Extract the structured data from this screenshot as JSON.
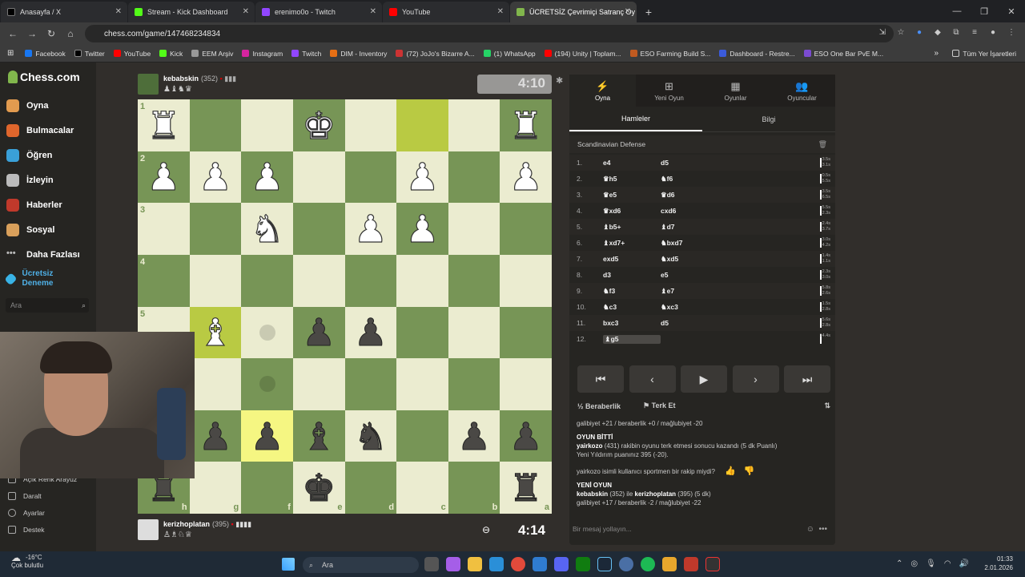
{
  "browser": {
    "tabs": [
      {
        "title": "Anasayfa / X",
        "color": "#000000"
      },
      {
        "title": "Stream - Kick Dashboard",
        "color": "#53fc18"
      },
      {
        "title": "erenimo0o - Twitch",
        "color": "#9146ff"
      },
      {
        "title": "YouTube",
        "color": "#ff0000"
      },
      {
        "title": "ÜCRETSİZ Çevrimiçi Satranç Oy",
        "color": "#81b64c"
      }
    ],
    "url": "chess.com/game/147468234834",
    "bookmarks": [
      "Facebook",
      "Twitter",
      "YouTube",
      "Kick",
      "EEM Arşiv",
      "Instagram",
      "Twitch",
      "DIM - Inventory",
      "(72) JoJo's Bizarre A...",
      "(1) WhatsApp",
      "(194) Unity | Toplam...",
      "ESO Farming Build S...",
      "Dashboard - Restre...",
      "ESO One Bar PvE M..."
    ],
    "bookmarks_all": "Tüm Yer İşaretleri"
  },
  "sidebar": {
    "logo": "Chess.com",
    "items": [
      "Oyna",
      "Bulmacalar",
      "Öğren",
      "İzleyin",
      "Haberler",
      "Sosyal",
      "Daha Fazlası",
      "Ücretsiz Deneme"
    ],
    "search_placeholder": "Ara",
    "bottom": [
      "Açık Renk Arayüz",
      "Daralt",
      "Ayarlar",
      "Destek"
    ]
  },
  "game": {
    "top_player": {
      "name": "kebabskin",
      "rating": "(352)",
      "clock": "4:10"
    },
    "bottom_player": {
      "name": "kerizhoplatan",
      "rating": "(395)",
      "clock": "4:14"
    },
    "ranks": [
      "1",
      "2",
      "3",
      "4",
      "5",
      "6",
      "7",
      "8"
    ],
    "files": [
      "h",
      "g",
      "f",
      "e",
      "d",
      "c",
      "b",
      "a"
    ],
    "board": [
      [
        "wR",
        "",
        "",
        "wK",
        "",
        "",
        "",
        "wR"
      ],
      [
        "wP",
        "wP",
        "wP",
        "",
        "",
        "wP",
        "",
        "wP"
      ],
      [
        "",
        "",
        "wN",
        "",
        "wP",
        "wP",
        "",
        ""
      ],
      [
        "",
        "",
        "",
        "",
        "",
        "",
        "",
        ""
      ],
      [
        "",
        "wB",
        "",
        "bP",
        "bP",
        "",
        "",
        ""
      ],
      [
        "",
        "",
        "",
        "",
        "",
        "",
        "",
        ""
      ],
      [
        "",
        "bP",
        "bP",
        "bB",
        "bN",
        "",
        "bP",
        "bP"
      ],
      [
        "bR",
        "",
        "",
        "bK",
        "",
        "",
        "",
        "bR"
      ]
    ]
  },
  "panel": {
    "tabs": [
      "Oyna",
      "Yeni Oyun",
      "Oyunlar",
      "Oyuncular"
    ],
    "subtabs": [
      "Hamleler",
      "Bilgi"
    ],
    "opening": "Scandinavian Defense",
    "moves": [
      {
        "n": "1.",
        "w": "e4",
        "b": "d5",
        "t1": "3.5s",
        "t2": "3.1s"
      },
      {
        "n": "2.",
        "w": "♛h5",
        "b": "♞f6",
        "t1": "0.5s",
        "t2": "5.5s"
      },
      {
        "n": "3.",
        "w": "♛e5",
        "b": "♛d6",
        "t1": "3.5s",
        "t2": "6.5s"
      },
      {
        "n": "4.",
        "w": "♛xd6",
        "b": "cxd6",
        "t1": "5.5s",
        "t2": "2.3s"
      },
      {
        "n": "5.",
        "w": "♝b5+",
        "b": "♝d7",
        "t1": "2.4s",
        "t2": "3.7s"
      },
      {
        "n": "6.",
        "w": "♝xd7+",
        "b": "♞bxd7",
        "t1": "3.0s",
        "t2": "4.2s"
      },
      {
        "n": "7.",
        "w": "exd5",
        "b": "♞xd5",
        "t1": "1.4s",
        "t2": "1.1s"
      },
      {
        "n": "8.",
        "w": "d3",
        "b": "e5",
        "t1": "2.3s",
        "t2": "3.0s"
      },
      {
        "n": "9.",
        "w": "♞f3",
        "b": "♝e7",
        "t1": "5.8s",
        "t2": "2.6s"
      },
      {
        "n": "10.",
        "w": "♞c3",
        "b": "♞xc3",
        "t1": "1.5s",
        "t2": "2.8s"
      },
      {
        "n": "11.",
        "w": "bxc3",
        "b": "d5",
        "t1": "5.6s",
        "t2": "2.8s"
      },
      {
        "n": "12.",
        "w": "♝g5",
        "b": "",
        "t1": "14.4s",
        "t2": ""
      }
    ],
    "draw": "Beraberlik",
    "resign": "Terk Et",
    "chat": {
      "line1": "galibiyet +21 / beraberlik +0 / mağlubiyet -20",
      "over": "OYUN BİTTİ",
      "line2a": "yairkozo",
      "line2b": " (431) rakibin oyunu terk etmesi sonucu kazandı (5 dk Puanlı)",
      "line3": "Yeni Yıldırım puanınız 395 (-20).",
      "q": "yairkozo isimli kullanıcı sportmen bir rakip miydi?",
      "new": "YENİ OYUN",
      "line4a": "kebabskin",
      "line4b": " (352) ile ",
      "line4c": "kerizhoplatan",
      "line4d": " (395) (5 dk)",
      "line5": "galibiyet +17 / beraberlik -2 / mağlubiyet -22"
    },
    "message_placeholder": "Bir mesaj yollayın..."
  },
  "taskbar": {
    "temp": "-16°C",
    "weather": "Çok bulutlu",
    "search": "Ara",
    "time": "01:33",
    "date": "2.01.2026"
  }
}
